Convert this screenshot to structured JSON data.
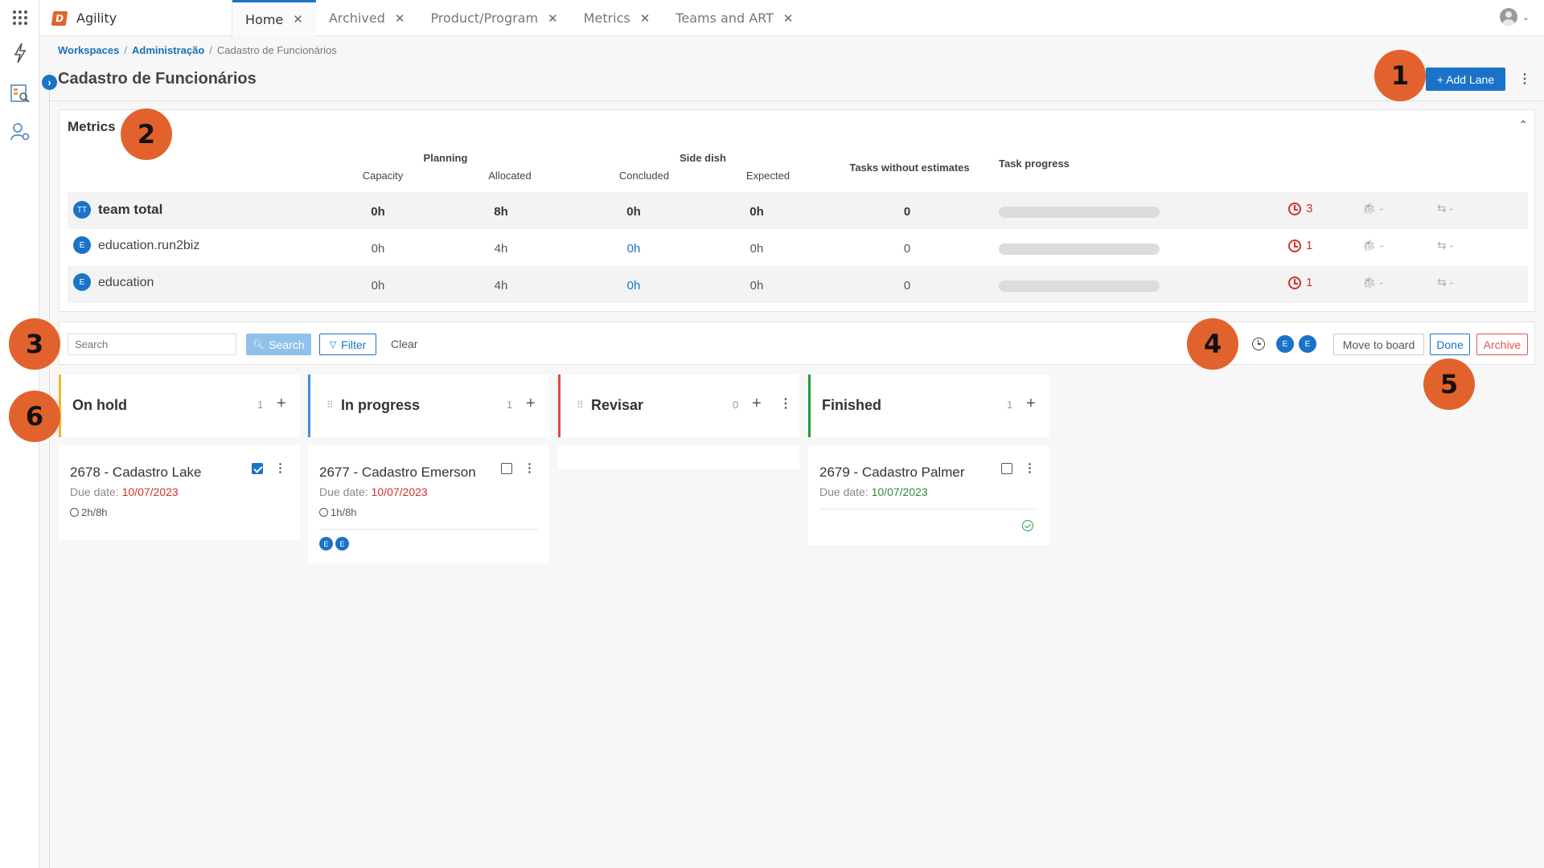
{
  "app": {
    "name": "Agility",
    "logo_letter": "D"
  },
  "tabs": [
    {
      "label": "Home",
      "active": true
    },
    {
      "label": "Archived"
    },
    {
      "label": "Product/Program"
    },
    {
      "label": "Metrics"
    },
    {
      "label": "Teams and ART"
    }
  ],
  "breadcrumb": {
    "items": [
      "Workspaces",
      "Administração",
      "Cadastro de Funcionários"
    ]
  },
  "page": {
    "title": "Cadastro de Funcionários",
    "add_lane_label": "+ Add Lane"
  },
  "metrics": {
    "title": "Metrics",
    "groups": {
      "planning": "Planning",
      "side_dish": "Side dish"
    },
    "columns": {
      "capacity": "Capacity",
      "allocated": "Allocated",
      "concluded": "Concluded",
      "expected": "Expected",
      "tasks_without_estimates": "Tasks without estimates",
      "task_progress": "Task progress"
    },
    "rows": [
      {
        "badge": "TT",
        "name": "team total",
        "capacity": "0h",
        "allocated": "8h",
        "concluded": "0h",
        "expected": "0h",
        "no_estimates": "0",
        "overdue": "3",
        "bugs": "-",
        "loops": "-"
      },
      {
        "badge": "E",
        "name": "education.run2biz",
        "capacity": "0h",
        "allocated": "4h",
        "concluded": "0h",
        "expected": "0h",
        "no_estimates": "0",
        "overdue": "1",
        "bugs": "-",
        "loops": "-"
      },
      {
        "badge": "E",
        "name": "education",
        "capacity": "0h",
        "allocated": "4h",
        "concluded": "0h",
        "expected": "0h",
        "no_estimates": "0",
        "overdue": "1",
        "bugs": "-",
        "loops": "-"
      }
    ]
  },
  "toolbar": {
    "search_placeholder": "Search",
    "search_label": "Search",
    "filter_label": "Filter",
    "clear_label": "Clear",
    "assignees": [
      "E",
      "E"
    ],
    "move_label": "Move to board",
    "done_label": "Done",
    "archive_label": "Archive"
  },
  "lanes": [
    {
      "title": "On hold",
      "count": "1",
      "color": "#f0b429"
    },
    {
      "title": "In progress",
      "count": "1",
      "color": "#3b8fd9"
    },
    {
      "title": "Revisar",
      "count": "0",
      "color": "#e04848"
    },
    {
      "title": "Finished",
      "count": "1",
      "color": "#1f9b3a"
    }
  ],
  "cards": [
    {
      "title": "2678 - Cadastro Lake",
      "due_label": "Due date:",
      "due": "10/07/2023",
      "time": "2h/8h",
      "checked": true
    },
    {
      "title": "2677 - Cadastro Emerson",
      "due_label": "Due date:",
      "due": "10/07/2023",
      "time": "1h/8h",
      "checked": false,
      "assignees": [
        "E",
        "E"
      ]
    },
    {
      "title": "2679 - Cadastro Palmer",
      "due_label": "Due date:",
      "due": "10/07/2023",
      "checked": false
    }
  ],
  "markers": [
    "1",
    "2",
    "3",
    "4",
    "5",
    "6"
  ],
  "colors": {
    "primary": "#1a73c8",
    "marker": "#e2622d",
    "danger": "#d0302f",
    "success": "#2e8b3e"
  }
}
